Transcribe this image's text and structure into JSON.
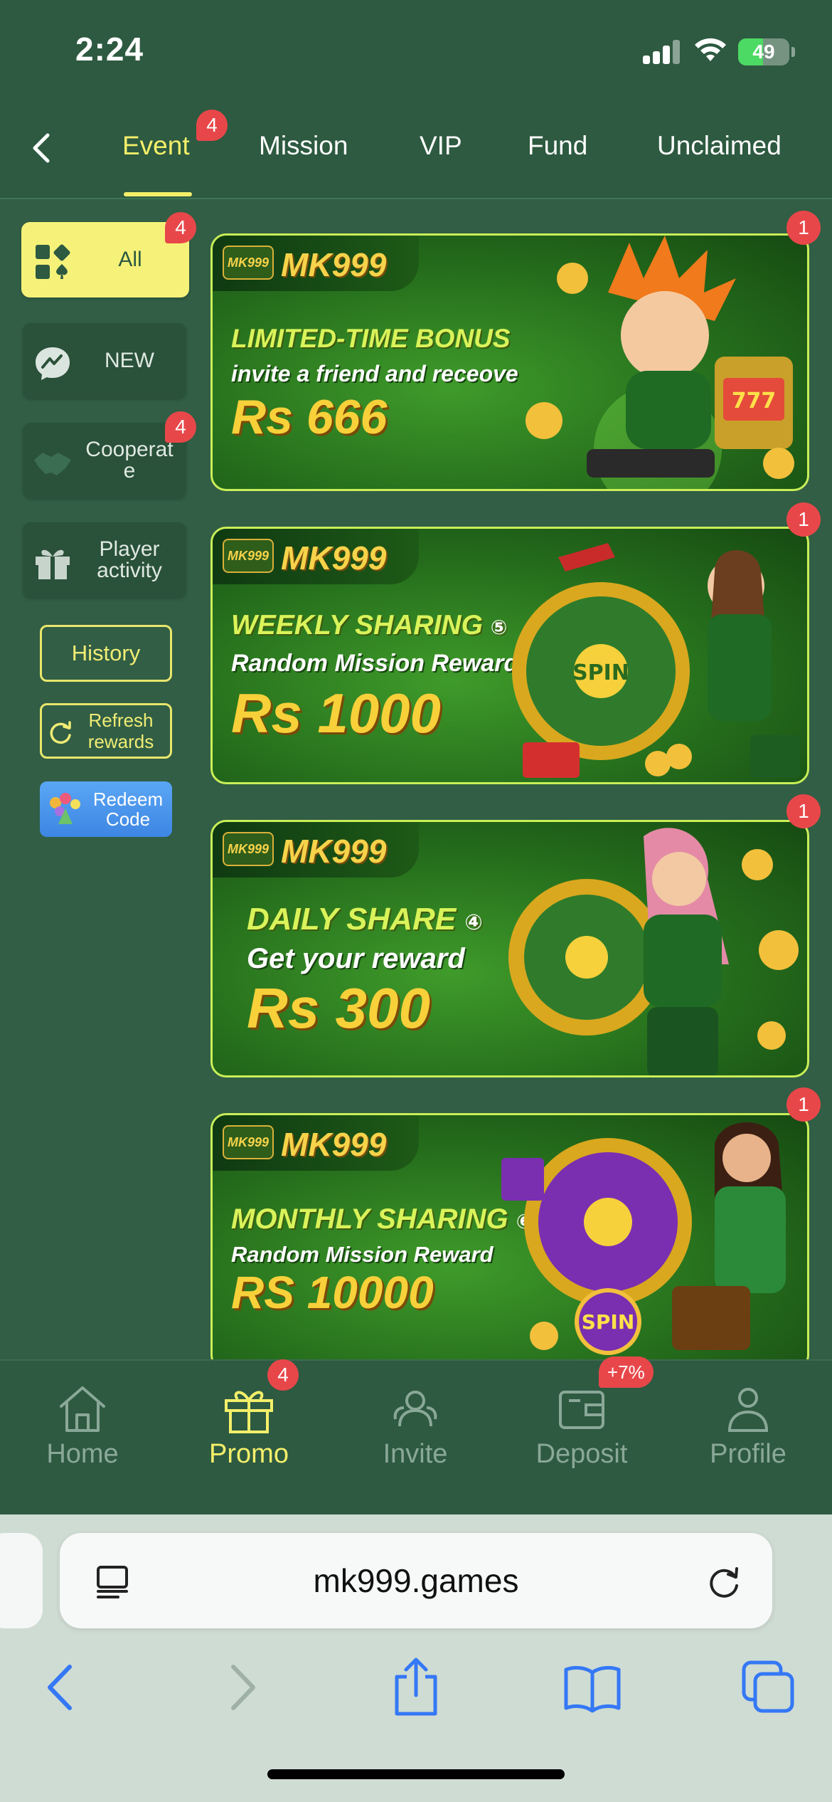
{
  "status_bar": {
    "time": "2:24",
    "battery": "49",
    "battery_level": 0.49
  },
  "top_tabs": [
    {
      "label": "Event",
      "active": true,
      "badge": "4"
    },
    {
      "label": "Mission"
    },
    {
      "label": "VIP"
    },
    {
      "label": "Fund"
    },
    {
      "label": "Unclaimed"
    }
  ],
  "sidebar": {
    "items": [
      {
        "label": "All",
        "active": true,
        "badge": "4",
        "icon": "grid-icon"
      },
      {
        "label": "NEW",
        "icon": "chat-bubble-icon"
      },
      {
        "label": "Cooperat\ne",
        "badge": "4",
        "icon": "handshake-icon"
      },
      {
        "label": "Player\nactivity",
        "icon": "gift-icon"
      }
    ],
    "history_label": "History",
    "refresh_label": "Refresh\nrewards",
    "redeem_label": "Redeem\nCode"
  },
  "banners": [
    {
      "brand": "MK999",
      "brand_mini": "MK999",
      "title": "LIMITED-TIME BONUS",
      "subtitle": "invite a friend and receove",
      "amount": "Rs 666",
      "badge": "1"
    },
    {
      "brand": "MK999",
      "brand_mini": "MK999",
      "title": "WEEKLY SHARING",
      "title_mark": "⑤",
      "subtitle": "Random Mission Reward",
      "amount": "Rs 1000",
      "art_text": "SPIN",
      "badge": "1"
    },
    {
      "brand": "MK999",
      "brand_mini": "MK999",
      "title": "DAILY SHARE",
      "title_mark": "④",
      "subtitle": "Get your reward",
      "amount": "Rs 300",
      "badge": "1"
    },
    {
      "brand": "MK999",
      "brand_mini": "MK999",
      "title": "MONTHLY SHARING",
      "title_mark": "⑥",
      "subtitle": "Random Mission Reward",
      "amount": "RS 10000",
      "art_text": "SPIN",
      "badge": "1"
    }
  ],
  "bottom_nav": [
    {
      "label": "Home",
      "icon": "home-icon"
    },
    {
      "label": "Promo",
      "icon": "gift-icon",
      "active": true,
      "badge": "4"
    },
    {
      "label": "Invite",
      "icon": "people-icon"
    },
    {
      "label": "Deposit",
      "icon": "wallet-icon",
      "badge": "+7%"
    },
    {
      "label": "Profile",
      "icon": "person-icon"
    }
  ],
  "browser": {
    "url": "mk999.games"
  },
  "colors": {
    "background": "#315e45",
    "accent_yellow": "#f4ef6a",
    "badge_red": "#e8474a",
    "safari_blue": "#3478f6"
  }
}
